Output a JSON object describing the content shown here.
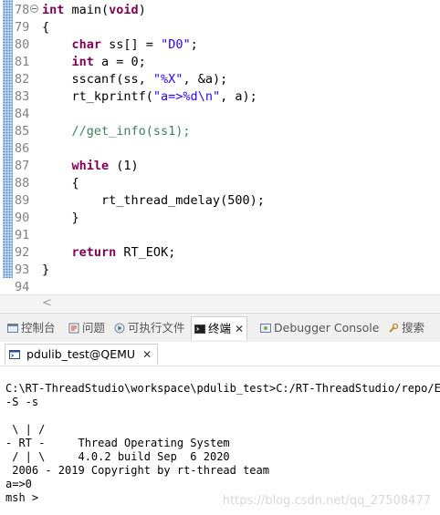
{
  "editor": {
    "lines": [
      {
        "num": "78",
        "fold": true,
        "segments": [
          {
            "t": "int",
            "c": "kw"
          },
          {
            "t": " main(",
            "c": ""
          },
          {
            "t": "void",
            "c": "kw"
          },
          {
            "t": ")",
            "c": ""
          }
        ]
      },
      {
        "num": "79",
        "segments": [
          {
            "t": "{",
            "c": ""
          }
        ]
      },
      {
        "num": "80",
        "segments": [
          {
            "t": "    ",
            "c": ""
          },
          {
            "t": "char",
            "c": "kw"
          },
          {
            "t": " ss[] = ",
            "c": ""
          },
          {
            "t": "\"D0\"",
            "c": "str"
          },
          {
            "t": ";",
            "c": ""
          }
        ]
      },
      {
        "num": "81",
        "segments": [
          {
            "t": "    ",
            "c": ""
          },
          {
            "t": "int",
            "c": "kw"
          },
          {
            "t": " a = 0;",
            "c": ""
          }
        ]
      },
      {
        "num": "82",
        "segments": [
          {
            "t": "    sscanf(ss, ",
            "c": ""
          },
          {
            "t": "\"%X\"",
            "c": "str"
          },
          {
            "t": ", &a);",
            "c": ""
          }
        ]
      },
      {
        "num": "83",
        "segments": [
          {
            "t": "    rt_kprintf(",
            "c": ""
          },
          {
            "t": "\"a=>%d\\n\"",
            "c": "str"
          },
          {
            "t": ", a);",
            "c": ""
          }
        ]
      },
      {
        "num": "84",
        "segments": []
      },
      {
        "num": "85",
        "segments": [
          {
            "t": "    ",
            "c": ""
          },
          {
            "t": "//get_info(ss1);",
            "c": "cmt"
          }
        ]
      },
      {
        "num": "86",
        "segments": []
      },
      {
        "num": "87",
        "segments": [
          {
            "t": "    ",
            "c": ""
          },
          {
            "t": "while",
            "c": "kw"
          },
          {
            "t": " (1)",
            "c": ""
          }
        ]
      },
      {
        "num": "88",
        "segments": [
          {
            "t": "    {",
            "c": ""
          }
        ]
      },
      {
        "num": "89",
        "segments": [
          {
            "t": "        rt_thread_mdelay(500);",
            "c": ""
          }
        ]
      },
      {
        "num": "90",
        "segments": [
          {
            "t": "    }",
            "c": ""
          }
        ]
      },
      {
        "num": "91",
        "segments": []
      },
      {
        "num": "92",
        "segments": [
          {
            "t": "    ",
            "c": ""
          },
          {
            "t": "return",
            "c": "kw"
          },
          {
            "t": " RT_EOK;",
            "c": ""
          }
        ]
      },
      {
        "num": "93",
        "segments": [
          {
            "t": "}",
            "c": ""
          }
        ]
      },
      {
        "num": "94",
        "segments": []
      }
    ],
    "hscroll_arrow": "<"
  },
  "tabs": [
    {
      "label": "控制台",
      "icon": "console-icon",
      "active": false
    },
    {
      "label": "问题",
      "icon": "problems-icon",
      "active": false
    },
    {
      "label": "可执行文件",
      "icon": "executables-icon",
      "active": false
    },
    {
      "label": "终端",
      "icon": "terminal-icon",
      "active": true,
      "close": "✕"
    },
    {
      "label": "Debugger Console",
      "icon": "debugger-console-icon",
      "active": false
    },
    {
      "label": "搜索",
      "icon": "search-icon",
      "active": false
    }
  ],
  "console_tab": {
    "label": "pdulib_test@QEMU",
    "close": "✕",
    "icon": "terminal-icon"
  },
  "console_lines": [
    "",
    "C:\\RT-ThreadStudio\\workspace\\pdulib_test>C:/RT-ThreadStudio/repo/Ext",
    "-S -s",
    "",
    " \\ | /",
    "- RT -     Thread Operating System",
    " / | \\     4.0.2 build Sep  6 2020",
    " 2006 - 2019 Copyright by rt-thread team",
    "a=>0",
    "msh >"
  ],
  "watermark": "https://blog.csdn.net/qq_27508477"
}
